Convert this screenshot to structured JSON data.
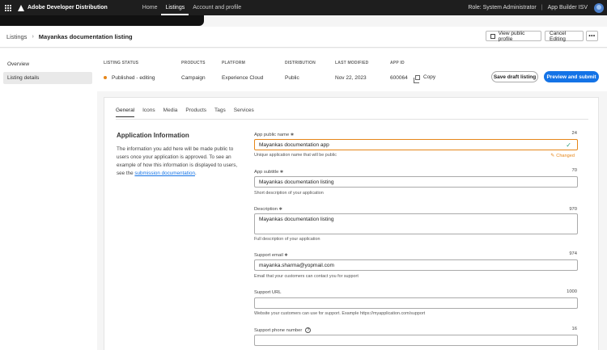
{
  "topbar": {
    "brand": "Adobe Developer Distribution",
    "nav": [
      "Home",
      "Listings",
      "Account and profile"
    ],
    "role": "Role: System Administrator",
    "sep": "|",
    "org": "App Builder ISV"
  },
  "header": {
    "breadcrumb_root": "Listings",
    "breadcrumb_current": "Mayankas documentation listing",
    "view_public_profile": "View public profile",
    "cancel_editing": "Cancel Editing",
    "more": "•••"
  },
  "sidebar": {
    "items": [
      "Overview",
      "Listing details"
    ]
  },
  "status": {
    "headers": {
      "listing_status": "LISTING STATUS",
      "products": "PRODUCTS",
      "platform": "PLATFORM",
      "distribution": "DISTRIBUTION",
      "last_modified": "LAST MODIFIED",
      "app_id": "APP ID"
    },
    "values": {
      "listing_status": "Published - editing",
      "products": "Campaign",
      "platform": "Experience Cloud",
      "distribution": "Public",
      "last_modified": "Nov 22, 2023",
      "app_id": "600064"
    },
    "copy_label": "Copy",
    "save_draft": "Save draft listing",
    "preview_submit": "Preview and submit",
    "status_color": "#e68619"
  },
  "tabs": [
    "General",
    "Icons",
    "Media",
    "Products",
    "Tags",
    "Services"
  ],
  "section": {
    "title": "Application Information",
    "desc": "The information you add here will be made public to users once your application is approved. To see an example of how this information is displayed to users, see the",
    "link": "submission documentation",
    "tail": "."
  },
  "fields": {
    "app_name": {
      "label": "App public name",
      "count": "24",
      "value": "Mayankas documentation app",
      "help": "Unique application name that will be public",
      "changed": "Changed"
    },
    "subtitle": {
      "label": "App subtitle",
      "count": "70",
      "value": "Mayankas documentation listing",
      "help": "Short description of your application"
    },
    "description": {
      "label": "Description",
      "count": "970",
      "value": "Mayankas documentation listing",
      "help": "Full description of your application"
    },
    "support_email": {
      "label": "Support email",
      "count": "974",
      "value": "mayanka.sharma@yopmail.com",
      "help": "Email that your customers can contact you for support"
    },
    "support_url": {
      "label": "Support URL",
      "count": "1000",
      "value": "",
      "help": "Website your customers can use for support. Example https://myapplication.com/support"
    },
    "support_phone": {
      "label": "Support phone number",
      "count": "16",
      "value": ""
    }
  },
  "required_mark": "✱"
}
